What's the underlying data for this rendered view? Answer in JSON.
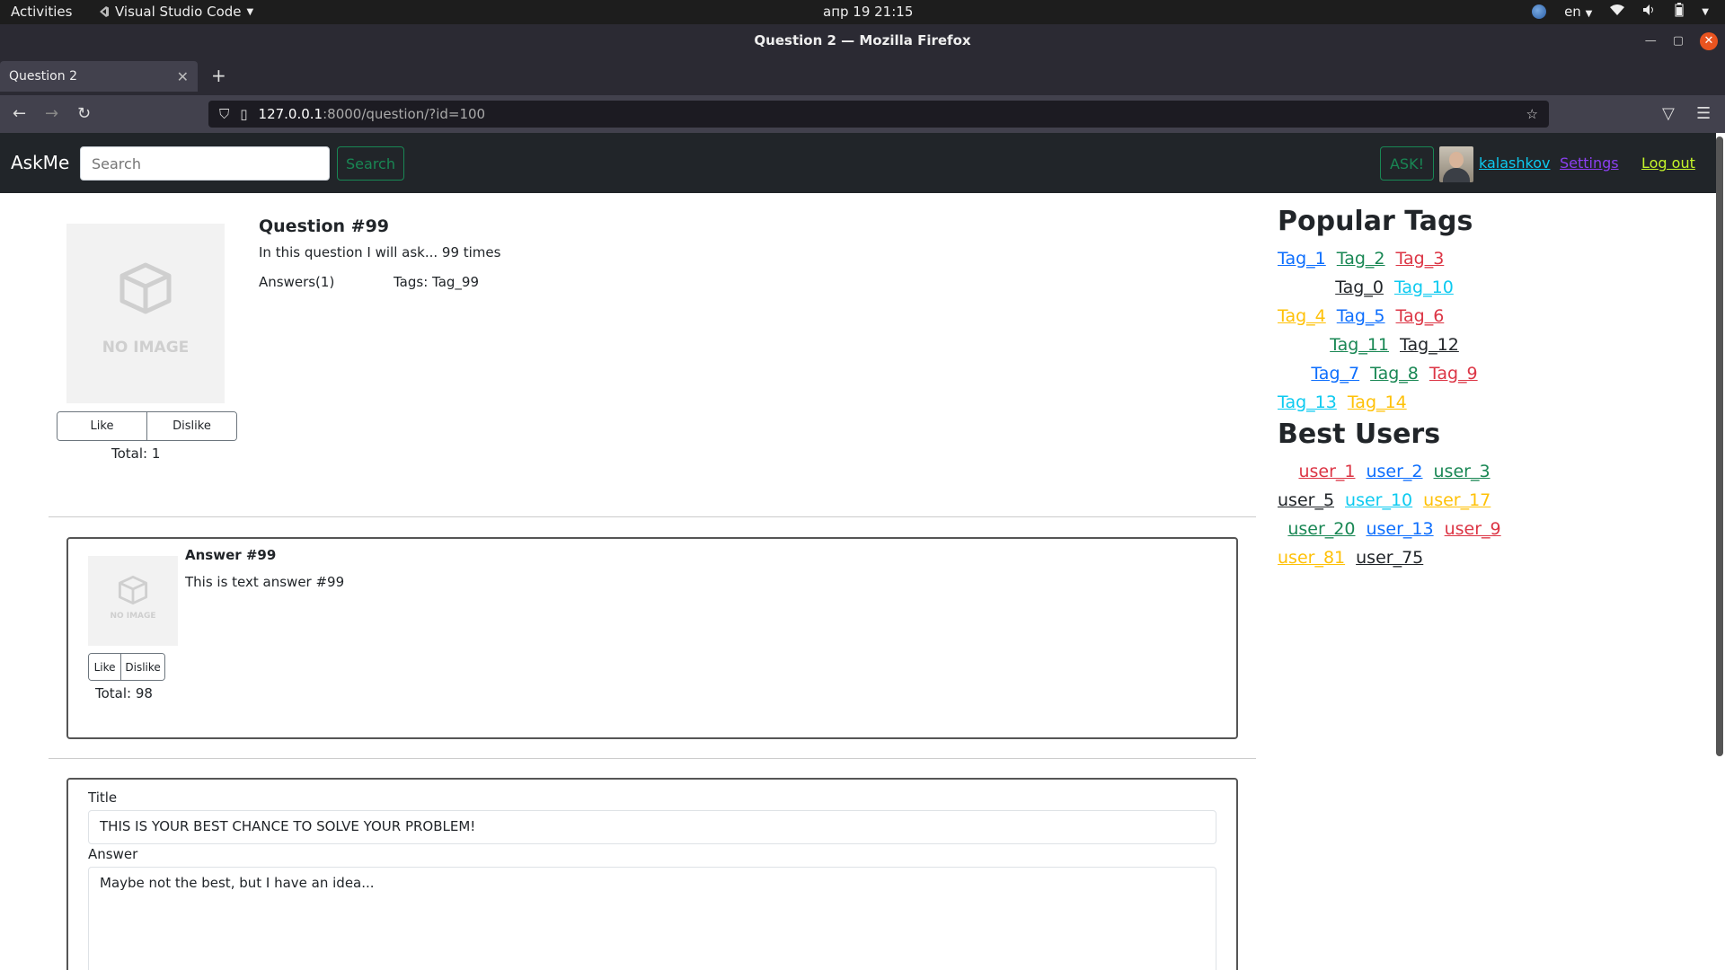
{
  "system": {
    "activities": "Activities",
    "app_name": "Visual Studio Code",
    "clock": "апр 19  21:15",
    "lang": "en"
  },
  "browser": {
    "window_title": "Question 2 — Mozilla Firefox",
    "tab_title": "Question 2",
    "url_host": "127.0.0.1",
    "url_rest": ":8000/question/?id=100"
  },
  "nav": {
    "brand": "AskMe",
    "search_placeholder": "Search",
    "search_button": "Search",
    "ask_button": "ASK!",
    "username": "kalashkov",
    "settings": "Settings",
    "logout": "Log out"
  },
  "question": {
    "image_text": "NO IMAGE",
    "title": "Question #99",
    "body": "In this question I will ask... 99 times",
    "answers": "Answers(1)",
    "tags": "Tags: Tag_99",
    "like": "Like",
    "dislike": "Dislike",
    "total": "Total: 1"
  },
  "answer": {
    "image_text": "NO IMAGE",
    "title": "Answer #99",
    "body": "This is text answer #99",
    "like": "Like",
    "dislike": "Dislike",
    "total": "Total: 98"
  },
  "form": {
    "title_label": "Title",
    "title_value": "THIS IS YOUR BEST CHANCE TO SOLVE YOUR PROBLEM!",
    "answer_label": "Answer",
    "answer_value": "Maybe not the best, but I have an idea..."
  },
  "sidebar": {
    "popular_tags_title": "Popular Tags",
    "tag_rows": [
      [
        {
          "label": "Tag_1",
          "color": "#0d6efd"
        },
        {
          "label": "Tag_2",
          "color": "#198754"
        },
        {
          "label": "Tag_3",
          "color": "#dc3545"
        }
      ],
      [
        {
          "label": "Tag_0",
          "color": "#212529"
        },
        {
          "label": "Tag_10",
          "color": "#0dcaf0"
        }
      ],
      [
        {
          "label": "Tag_4",
          "color": "#ffc107"
        },
        {
          "label": "Tag_5",
          "color": "#0d6efd"
        },
        {
          "label": "Tag_6",
          "color": "#dc3545"
        }
      ],
      [
        {
          "label": "Tag_11",
          "color": "#198754"
        },
        {
          "label": "Tag_12",
          "color": "#212529"
        }
      ],
      [
        {
          "label": "Tag_7",
          "color": "#0d6efd"
        },
        {
          "label": "Tag_8",
          "color": "#198754"
        },
        {
          "label": "Tag_9",
          "color": "#dc3545"
        }
      ],
      [
        {
          "label": "Tag_13",
          "color": "#0dcaf0"
        },
        {
          "label": "Tag_14",
          "color": "#ffc107"
        }
      ]
    ],
    "best_users_title": "Best Users",
    "user_rows": [
      [
        {
          "label": "user_1",
          "color": "#dc3545"
        },
        {
          "label": "user_2",
          "color": "#0d6efd"
        },
        {
          "label": "user_3",
          "color": "#198754"
        }
      ],
      [
        {
          "label": "user_5",
          "color": "#212529"
        },
        {
          "label": "user_10",
          "color": "#0dcaf0"
        },
        {
          "label": "user_17",
          "color": "#ffc107"
        }
      ],
      [
        {
          "label": "user_20",
          "color": "#198754"
        },
        {
          "label": "user_13",
          "color": "#0d6efd"
        },
        {
          "label": "user_9",
          "color": "#dc3545"
        }
      ],
      [
        {
          "label": "user_81",
          "color": "#ffc107"
        },
        {
          "label": "user_75",
          "color": "#212529"
        }
      ]
    ]
  }
}
